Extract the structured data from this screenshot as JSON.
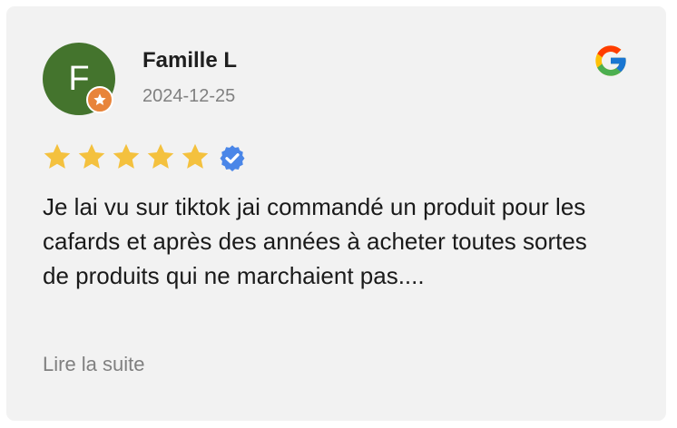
{
  "review": {
    "author": "Famille L",
    "avatar_letter": "F",
    "avatar_color": "#44742d",
    "badge_color": "#e8843a",
    "date": "2024-12-25",
    "source_icon": "google-icon",
    "rating": 5,
    "max_rating": 5,
    "star_color": "#f4c13e",
    "verified_icon": "verified-badge-icon",
    "verified_color": "#4a86e8",
    "text": "Je lai vu sur tiktok jai commandé un produit pour les cafards et après des années à acheter toutes sortes de produits qui ne marchaient pas....",
    "read_more_label": "Lire la suite"
  }
}
